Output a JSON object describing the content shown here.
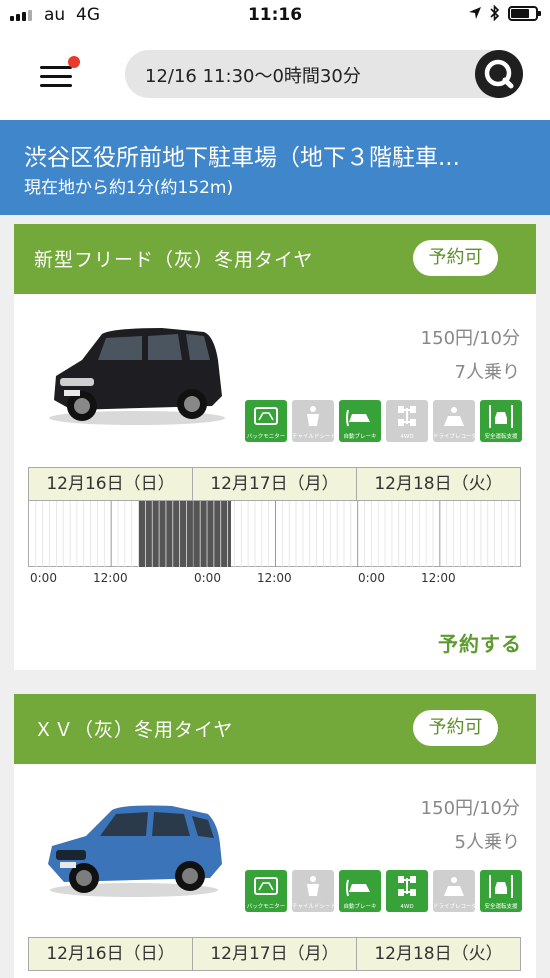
{
  "status_bar": {
    "carrier": "au",
    "network": "4G",
    "time": "11:16"
  },
  "header": {
    "search_value": "12/16 11:30〜0時間30分"
  },
  "parking": {
    "name": "渋谷区役所前地下駐車場（地下３階駐車...",
    "distance": "現在地から約1分(約152m)"
  },
  "cars": [
    {
      "title": "新型フリード（灰）冬用タイヤ",
      "status": "予約可",
      "price": "150円/10分",
      "seats": "7人乗り",
      "car_color": "#1e1e22",
      "features": [
        {
          "label": "バックモニター",
          "icon": "back-monitor-icon",
          "enabled": true
        },
        {
          "label": "チャイルドシート",
          "icon": "child-seat-icon",
          "enabled": false
        },
        {
          "label": "自動ブレーキ",
          "icon": "auto-brake-icon",
          "enabled": true
        },
        {
          "label": "4WD",
          "icon": "four-wd-icon",
          "enabled": false
        },
        {
          "label": "ドライブレコーダー",
          "icon": "drive-recorder-icon",
          "enabled": false
        },
        {
          "label": "安全運転支援",
          "icon": "safe-driving-icon",
          "enabled": true
        }
      ],
      "calendar": {
        "days": [
          "12月16日（日）",
          "12月17日（月）",
          "12月18日（火）"
        ],
        "times": [
          "0:00",
          "12:00",
          "0:00",
          "12:00",
          "0:00",
          "12:00"
        ],
        "booked_from_hour": 16,
        "booked_to_hour": 29.5
      },
      "reserve_label": "予約する"
    },
    {
      "title": "ＸＶ（灰）冬用タイヤ",
      "status": "予約可",
      "price": "150円/10分",
      "seats": "5人乗り",
      "car_color": "#3b74b8",
      "features": [
        {
          "label": "バックモニター",
          "icon": "back-monitor-icon",
          "enabled": true
        },
        {
          "label": "チャイルドシート",
          "icon": "child-seat-icon",
          "enabled": false
        },
        {
          "label": "自動ブレーキ",
          "icon": "auto-brake-icon",
          "enabled": true
        },
        {
          "label": "4WD",
          "icon": "four-wd-icon",
          "enabled": true
        },
        {
          "label": "ドライブレコーダー",
          "icon": "drive-recorder-icon",
          "enabled": false
        },
        {
          "label": "安全運転支援",
          "icon": "safe-driving-icon",
          "enabled": true
        }
      ],
      "calendar": {
        "days": [
          "12月16日（日）",
          "12月17日（月）",
          "12月18日（火）"
        ]
      }
    }
  ],
  "colors": {
    "accent_green": "#73a93a",
    "banner_blue": "#3f86cb",
    "booked_gray": "#555555"
  }
}
